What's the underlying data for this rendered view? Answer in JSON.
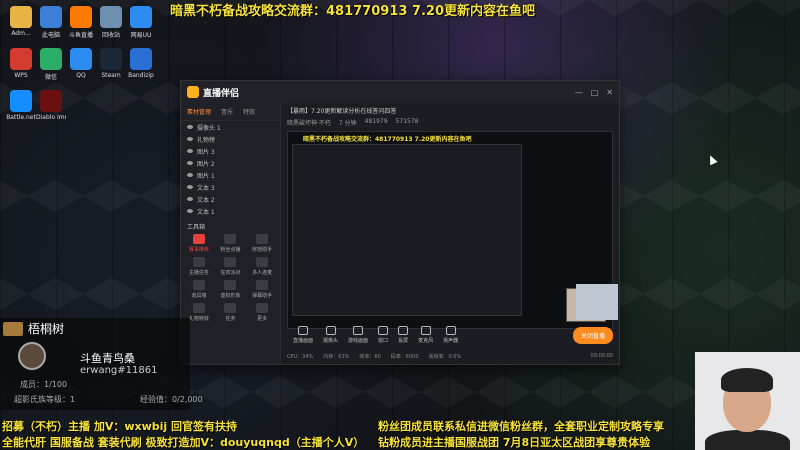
{
  "banner": "暗黑不朽备战攻略交流群：481770913 7.20更新内容在鱼吧",
  "app": {
    "title": "直播伴侣",
    "tabs": [
      "素材管理",
      "音乐",
      "特效"
    ],
    "layers": [
      "摄像头 1",
      "礼物榜",
      "图片 3",
      "图片 2",
      "图片 1",
      "文本 3",
      "文本 2",
      "文本 1"
    ],
    "tools_title": "工具箱",
    "tools": [
      "赛事推荐",
      "粉丝点播",
      "房管助手",
      "主播任务",
      "狂欢派对",
      "多人连麦",
      "道具墙",
      "虚拟形象",
      "弹幕助手",
      "礼物特效",
      "任务",
      "更多"
    ],
    "stream_title": "【暴雨】7.20更新解读分析在线答问四答",
    "stream_meta": [
      "暗黑破坏神·不朽",
      "7 分钟",
      "481979",
      "571578"
    ],
    "preview_banner": "暗黑不朽备战攻略交流群：481770913 7.20更新内容在鱼吧",
    "toolbar": [
      "直播画面",
      "摄像头",
      "游戏画面",
      "窗口",
      "投屏",
      "麦克风",
      "扬声器"
    ],
    "live_button": "关闭直播",
    "status": [
      "CPU：34%",
      "内存：62%",
      "帧率：60",
      "码率：6000",
      "丢帧率：0.0%"
    ],
    "timer": "00:00:00"
  },
  "overlay": {
    "name": "梧桐树",
    "title": "斗鱼青鸟桑",
    "id": "erwang#11861",
    "rank": "成员：1/100",
    "level": "超影氏族等级：1",
    "exp": "经验值：0/2,000"
  },
  "bottom": {
    "left1": "招募（不朽）主播 加V：wxwbij 回官签有扶持",
    "left2": "全能代肝 国服备战 套装代刷 极致打造加V：douyuqnqd（主播个人V）",
    "right1": "粉丝团成员联系私信进微信粉丝群，全套职业定制攻略专享",
    "right2": "钻粉成员进主播国服战团 7月8日亚太区战团享尊贵体验"
  },
  "desktop_icons": [
    {
      "label": "Adm...",
      "color": "#e8b447"
    },
    {
      "label": "此电脑",
      "color": "#3b80d8"
    },
    {
      "label": "斗鱼直播",
      "color": "#ff7a00"
    },
    {
      "label": "回收站",
      "color": "#6f8fb0"
    },
    {
      "label": "网易UU",
      "color": "#2d8cf0"
    },
    {
      "label": "WPS",
      "color": "#d43b30"
    },
    {
      "label": "微信",
      "color": "#2aae67"
    },
    {
      "label": "QQ",
      "color": "#2d8cf0"
    },
    {
      "label": "Steam",
      "color": "#1b2838"
    },
    {
      "label": "Bandizip",
      "color": "#2a6fd4"
    },
    {
      "label": "Battle.net",
      "color": "#148eff"
    },
    {
      "label": "Diablo Immortal",
      "color": "#6b1010"
    }
  ]
}
